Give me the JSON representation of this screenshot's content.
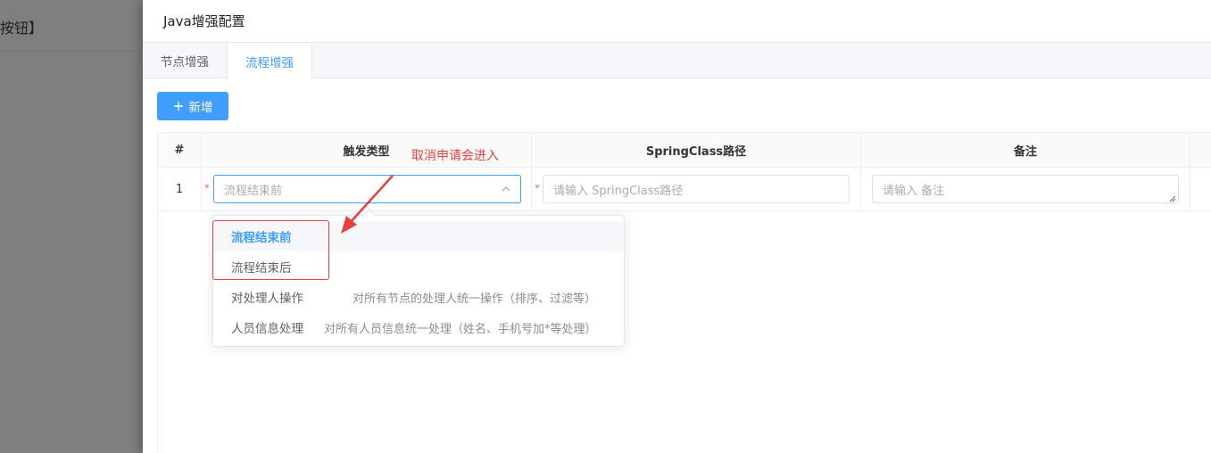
{
  "backdrop": {
    "text": "按钮】"
  },
  "drawer": {
    "title": "Java增强配置"
  },
  "tabs": [
    {
      "label": "节点增强",
      "active": false
    },
    {
      "label": "流程增强",
      "active": true
    }
  ],
  "toolbar": {
    "add_label": "新增",
    "add_icon": "plus-icon"
  },
  "table": {
    "headers": [
      "#",
      "触发类型",
      "SpringClass路径",
      "备注"
    ],
    "rows": [
      {
        "index": "1",
        "trigger_placeholder": "流程结束前",
        "springclass_placeholder": "请输入 SpringClass路径",
        "remark_placeholder": "请输入 备注"
      }
    ]
  },
  "dropdown": {
    "options": [
      {
        "label": "流程结束前",
        "desc": "",
        "selected": true
      },
      {
        "label": "流程结束后",
        "desc": "",
        "selected": false
      },
      {
        "label": "对处理人操作",
        "desc": "对所有节点的处理人统一操作（排序、过滤等）",
        "selected": false
      },
      {
        "label": "人员信息处理",
        "desc": "对所有人员信息统一处理（姓名、手机号加*等处理）",
        "selected": false
      }
    ]
  },
  "annotation": {
    "text": "取消申请会进入",
    "color": "#e84040"
  },
  "colors": {
    "primary": "#409eff",
    "danger": "#f56c6c",
    "annotation": "#e84040"
  }
}
